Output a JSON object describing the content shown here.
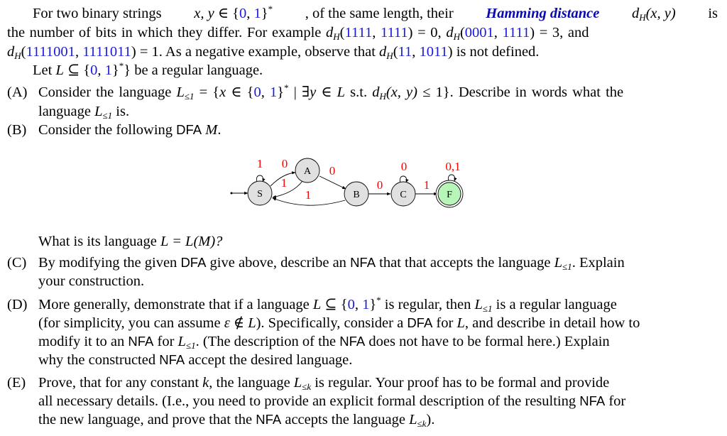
{
  "intro": {
    "line1": {
      "a": "For two binary strings ",
      "xy": "x, y",
      "in": " ∈ {",
      "zero": "0",
      "comma": ", ",
      "one": "1",
      "close": "}",
      "star": "*",
      "b": ", of the same length, their ",
      "term": "Hamming distance",
      "d": "d",
      "H": "H",
      "args": "(x, y)",
      "c": " is"
    },
    "line2": {
      "a": "the number of bits in which they differ.  For example ",
      "ex1_a": "1111",
      "ex1_b": "1111",
      "ex1_val": " = 0, ",
      "ex2_a": "0001",
      "ex2_b": "1111",
      "ex2_val": " = 3, and"
    },
    "line3": {
      "ex3_a": "1111001",
      "ex3_b": "1111011",
      "ex3_val": " = 1. As a negative example, observe that ",
      "ex4_a": "11",
      "ex4_b": "1011",
      "b": " is not defined."
    },
    "line4": {
      "a": "Let ",
      "L": "L",
      "b": " ⊆ {",
      "c": "} be a regular language."
    }
  },
  "parts": {
    "A": {
      "marker": "(A)",
      "l1a": "Consider the language ",
      "l1b": " = {",
      "x": "x",
      "l1c": " ∈ {",
      "l1d": " | ∃",
      "y": "y",
      "l1e": " ∈ ",
      "l1f": " s.t. ",
      "l1g": " ≤ 1}.  Describe in words what the",
      "l2a": "language ",
      "l2b": " is.",
      "sub": "≤1"
    },
    "B": {
      "marker": "(B)",
      "text": "Consider the following ",
      "dfa": "DFA",
      "M": "M",
      "dot": ".",
      "question_a": "What is its language ",
      "question_b": " = L(M)?"
    },
    "C": {
      "marker": "(C)",
      "l1a": "By modifying the given ",
      "dfa": "DFA",
      "l1b": " give above, describe an ",
      "nfa": "NFA",
      "l1c": " that that accepts the language ",
      "l1d": ".  Explain",
      "l2": "your construction."
    },
    "D": {
      "marker": "(D)",
      "l1a": "More generally, demonstrate that if a language ",
      "l1b": " is regular, then ",
      "l1c": " is a regular language",
      "l2a": "(for simplicity, you can assume ",
      "eps": "ε ∉ L",
      "l2b": "). Specifically, consider a ",
      "dfa": "DFA",
      "l2c": " for ",
      "l2d": ", and describe in detail how to",
      "l3a": "modify it to an ",
      "nfa": "NFA",
      "l3b": " for ",
      "l3c": ". (The description of the ",
      "l3d": " does not have to be formal here.)  Explain",
      "l4a": "why the constructed ",
      "l4b": " accept the desired language."
    },
    "E": {
      "marker": "(E)",
      "l1a": "Prove, that for any constant ",
      "k": "k",
      "l1b": ", the language ",
      "subk": "≤k",
      "l1c": " is regular.  Your proof has to be formal and provide",
      "l2a": "all necessary details.  (I.e., you need to provide an explicit formal description of the resulting ",
      "nfa": "NFA",
      "l2b": " for",
      "l3a": "the new language, and prove that the ",
      "l3b": " accepts the language ",
      "l3c": ")."
    }
  },
  "dfa": {
    "node_fill": "#e0e0e0",
    "accept_fill": "#b8f5b8",
    "label_color": "#ff0000",
    "states": [
      {
        "id": "S",
        "label": "S",
        "start": true,
        "accepting": false
      },
      {
        "id": "A",
        "label": "A",
        "start": false,
        "accepting": false
      },
      {
        "id": "B",
        "label": "B",
        "start": false,
        "accepting": false
      },
      {
        "id": "C",
        "label": "C",
        "start": false,
        "accepting": false
      },
      {
        "id": "F",
        "label": "F",
        "start": false,
        "accepting": true
      }
    ],
    "transitions": [
      {
        "from": "S",
        "to": "S",
        "label": "1"
      },
      {
        "from": "S",
        "to": "A",
        "label": "0"
      },
      {
        "from": "A",
        "to": "S",
        "label": "1"
      },
      {
        "from": "A",
        "to": "B",
        "label": "0"
      },
      {
        "from": "B",
        "to": "S",
        "label": "1"
      },
      {
        "from": "B",
        "to": "C",
        "label": "0"
      },
      {
        "from": "C",
        "to": "C",
        "label": "0"
      },
      {
        "from": "C",
        "to": "F",
        "label": "1"
      },
      {
        "from": "F",
        "to": "F",
        "label": "0,1"
      }
    ]
  }
}
